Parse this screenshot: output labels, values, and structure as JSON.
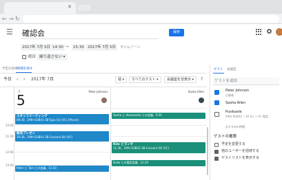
{
  "header": {
    "title": "確認会",
    "save_label": "保存"
  },
  "when": {
    "start_date": "2017年 7月 5日",
    "start_time": "14:30",
    "to": "～",
    "end_time": "15:30",
    "end_date": "2017年 7月 5日",
    "timezone": "タイムゾーン",
    "all_day_label": "終日",
    "repeat": "繰り返さない"
  },
  "tabs": {
    "details": "予定の詳細",
    "find_time": "時間を探す"
  },
  "calendar_toolbar": {
    "today": "今日",
    "month": "2017年 7月",
    "view": "週",
    "guests_filter": "すべてのゲスト",
    "rooms_filter": "会議室を非表示"
  },
  "day": {
    "weekday": "水",
    "number": "5",
    "people": [
      "Peter Johnson",
      "Sasha Allen"
    ]
  },
  "hours": [
    "10:00",
    "11:00",
    "12:00",
    "13:00"
  ],
  "events": [
    {
      "title": "スタッフミーティング",
      "detail": "09:30、29th-SUBA1-3B-Typo (5) (VC) (Phone)"
    },
    {
      "title": "販売プレゼン",
      "detail": "10:30、29th-SUBA1-3B-Cocoant (8) (VC)"
    },
    {
      "title": "Peter と Tom との会議、13:30",
      "detail": ""
    },
    {
      "title": "Sasha と Alessandro との会議、9:30",
      "detail": ""
    },
    {
      "title": "Kim とランチ",
      "detail": "11:30、29th-SUBA1-3B-Cocoant (8) (VC)"
    },
    {
      "title": "Duke との電話会議、12:30",
      "detail": ""
    }
  ],
  "right_panel": {
    "tab_guests": "ゲスト",
    "tab_rooms": "会議室",
    "add_guests_placeholder": "ゲストを追加",
    "guests": [
      {
        "name": "Peter Johnson",
        "sub": "主催者"
      },
      {
        "name": "Sasha Allen",
        "sub": ""
      },
      {
        "name": "Pusikaste",
        "sub": "29th-SUBA1 • 3A 4人 • VC 電話"
      }
    ],
    "suggest": "おすすめの時間",
    "permissions_title": "ゲストの権限",
    "permissions": [
      {
        "label": "予定を変更する",
        "checked": false
      },
      {
        "label": "他のユーザーを招待する",
        "checked": true
      },
      {
        "label": "ゲストリストを表示する",
        "checked": true
      }
    ]
  }
}
